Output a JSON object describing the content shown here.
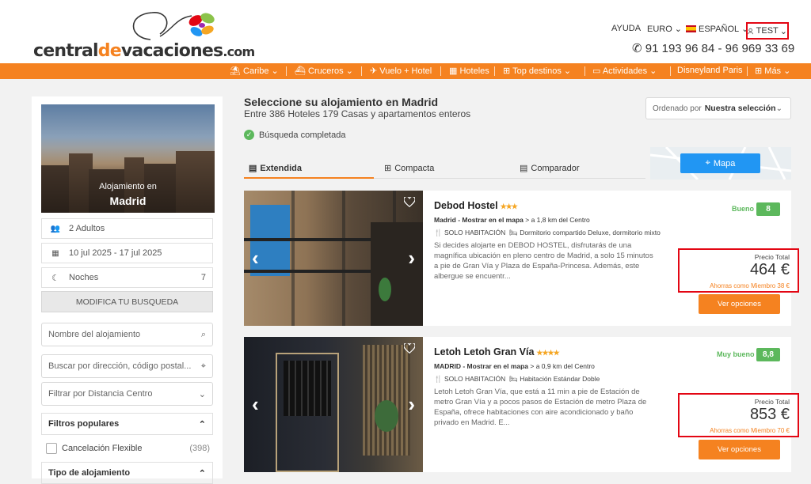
{
  "header": {
    "logo": {
      "part1": "central",
      "part2": "de",
      "part3": "vacaciones",
      "tld": ".com"
    },
    "help": "AYUDA",
    "currency": "EURO",
    "language": "ESPAÑOL",
    "user": "TEST",
    "phone": "91 193 96 84 - 96 969 33 69"
  },
  "nav": {
    "items": [
      "Caribe",
      "Cruceros",
      "Vuelo + Hotel",
      "Hoteles",
      "Top destinos",
      "Actividades",
      "Disneyland Paris",
      "Más"
    ]
  },
  "sidebar": {
    "hero_line1": "Alojamiento en",
    "hero_line2": "Madrid",
    "guests": "2 Adultos",
    "dates": "10 jul 2025 - 17 jul 2025",
    "nights_label": "Noches",
    "nights_value": "7",
    "modify_button": "MODIFICA TU BUSQUEDA",
    "name_placeholder": "Nombre del alojamiento",
    "address_placeholder": "Buscar por dirección, código postal...",
    "distance_select": "Filtrar por Distancia Centro",
    "popular_title": "Filtros populares",
    "filter_flexible": "Cancelación Flexible",
    "filter_flexible_count": "(398)",
    "type_title": "Tipo de alojamiento"
  },
  "results": {
    "title": "Seleccione su alojamiento en Madrid",
    "subtitle": "Entre 386 Hoteles 179 Casas y apartamentos enteros",
    "status": "Búsqueda completada",
    "sort_label": "Ordenado por",
    "sort_value": "Nuestra selección",
    "tabs": [
      "Extendida",
      "Compacta",
      "Comparador"
    ],
    "map_button": "Mapa"
  },
  "hotels": [
    {
      "name": "Debod Hostel",
      "stars": 3,
      "stars_text": "★★★",
      "location": "Madrid - Mostrar en el mapa",
      "distance": " > a 1,8 km del Centro",
      "regime": "SOLO HABITACIÓN",
      "room": "Dormitorio compartido Deluxe, dormitorio mixto",
      "description": "Si decides alojarte en DEBOD HOSTEL, disfrutarás de una magnífica ubicación en pleno centro de Madrid, a solo 15 minutos a pie de Gran Vía y Plaza de España-Princesa. Además, este albergue se encuentr...",
      "rating_word": "Bueno",
      "rating": "8",
      "price_label": "Precio Total",
      "price": "464 €",
      "savings": "Ahorras como Miembro 38 €",
      "button": "Ver opciones"
    },
    {
      "name": "Letoh Letoh Gran Vía",
      "stars": 4,
      "stars_text": "★★★★",
      "location": "MADRID - Mostrar en el mapa",
      "distance": " > a 0,9 km del Centro",
      "regime": "SOLO HABITACIÓN",
      "room": "Habitación Estándar Doble",
      "description": "Letoh Letoh Gran Vía, que está a 11 min a pie de Estación de metro Gran Vía y a pocos pasos de Estación de metro Plaza de España, ofrece habitaciones con aire acondicionado y baño privado en Madrid. E...",
      "rating_word": "Muy bueno",
      "rating": "8,8",
      "price_label": "Precio Total",
      "price": "853 €",
      "savings": "Ahorras como Miembro 70 €",
      "button": "Ver opciones"
    }
  ],
  "colors": {
    "brand_orange": "#f58220",
    "highlight_red": "#e30613",
    "rating_green": "#5cb85c",
    "map_blue": "#2196f3"
  }
}
